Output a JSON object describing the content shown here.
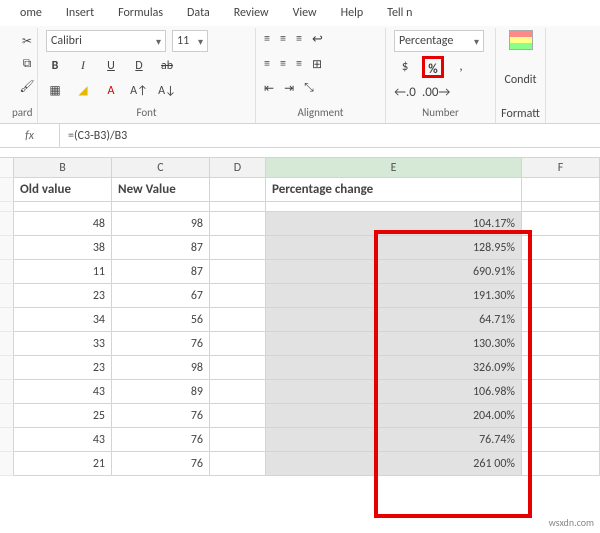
{
  "tabs": {
    "home": "ome",
    "insert": "Insert",
    "formulas": "Formulas",
    "data": "Data",
    "review": "Review",
    "view": "View",
    "help": "Help",
    "tell": "Tell n"
  },
  "clipboard": {
    "label": "pard"
  },
  "font": {
    "name": "Calibri",
    "size": "11",
    "label": "Font"
  },
  "align": {
    "label": "Alignment"
  },
  "number": {
    "format": "Percentage",
    "label": "Number",
    "dollar": "$",
    "percent": "%",
    "comma": ",",
    "dec1": ".0",
    "dec2": ".00"
  },
  "cond": {
    "l1": "Condit",
    "l2": "Formatt"
  },
  "formula": {
    "fx": "fx",
    "value": "=(C3-B3)/B3"
  },
  "columns": {
    "B": "B",
    "C": "C",
    "D": "D",
    "E": "E",
    "F": "F"
  },
  "headers": {
    "old": "Old value",
    "new": "New Value",
    "pct": "Percentage change"
  },
  "rows": [
    {
      "old": "48",
      "new": "98",
      "pct": "104.17%"
    },
    {
      "old": "38",
      "new": "87",
      "pct": "128.95%"
    },
    {
      "old": "11",
      "new": "87",
      "pct": "690.91%"
    },
    {
      "old": "23",
      "new": "67",
      "pct": "191.30%"
    },
    {
      "old": "34",
      "new": "56",
      "pct": "64.71%"
    },
    {
      "old": "33",
      "new": "76",
      "pct": "130.30%"
    },
    {
      "old": "23",
      "new": "98",
      "pct": "326.09%"
    },
    {
      "old": "43",
      "new": "89",
      "pct": "106.98%"
    },
    {
      "old": "25",
      "new": "76",
      "pct": "204.00%"
    },
    {
      "old": "43",
      "new": "76",
      "pct": "76.74%"
    },
    {
      "old": "21",
      "new": "76",
      "pct": "261 00%"
    }
  ],
  "chart_data": {
    "type": "table",
    "title": "Percentage change",
    "columns": [
      "Old value",
      "New Value",
      "Percentage change"
    ],
    "rows": [
      [
        48,
        98,
        1.0417
      ],
      [
        38,
        87,
        1.2895
      ],
      [
        11,
        87,
        6.9091
      ],
      [
        23,
        67,
        1.913
      ],
      [
        34,
        56,
        0.6471
      ],
      [
        33,
        76,
        1.303
      ],
      [
        23,
        98,
        3.2609
      ],
      [
        43,
        89,
        1.0698
      ],
      [
        25,
        76,
        2.04
      ],
      [
        43,
        76,
        0.7674
      ]
    ]
  },
  "watermark": "wsxdn.com"
}
